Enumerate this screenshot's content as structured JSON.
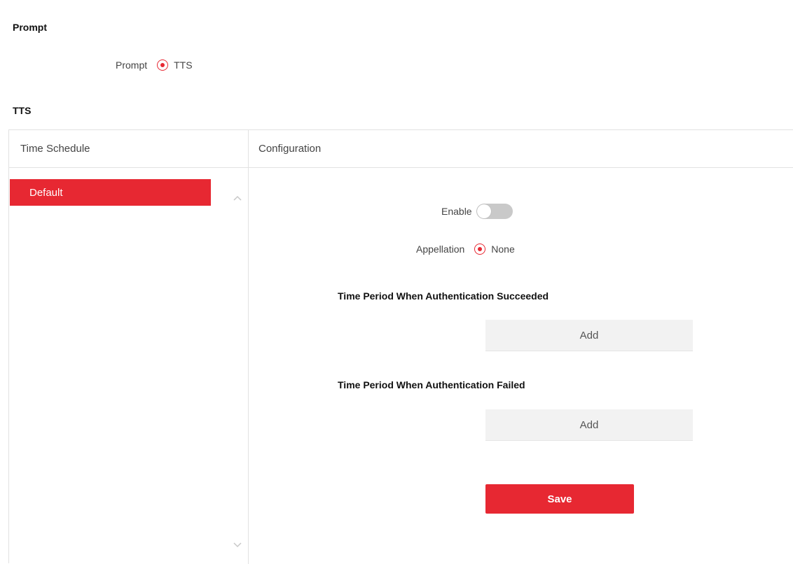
{
  "prompt_section": {
    "title": "Prompt",
    "field_label": "Prompt",
    "option_label": "TTS"
  },
  "tts_section": {
    "title": "TTS"
  },
  "time_schedule": {
    "header": "Time Schedule",
    "items": [
      {
        "label": "Default",
        "selected": true
      }
    ]
  },
  "configuration": {
    "header": "Configuration",
    "enable_label": "Enable",
    "enable_value": false,
    "appellation_label": "Appellation",
    "appellation_option": "None",
    "success_title": "Time Period When Authentication Succeeded",
    "success_add_label": "Add",
    "failed_title": "Time Period When Authentication Failed",
    "failed_add_label": "Add",
    "save_label": "Save"
  },
  "colors": {
    "accent": "#e72832",
    "toggle_off": "#c9c9c9",
    "add_button_bg": "#f2f2f2",
    "border": "#e2e2e2"
  },
  "icons": {
    "radio_selected": "radio-selected-icon",
    "scroll_up": "chevron-up-icon",
    "scroll_down": "chevron-down-icon"
  }
}
